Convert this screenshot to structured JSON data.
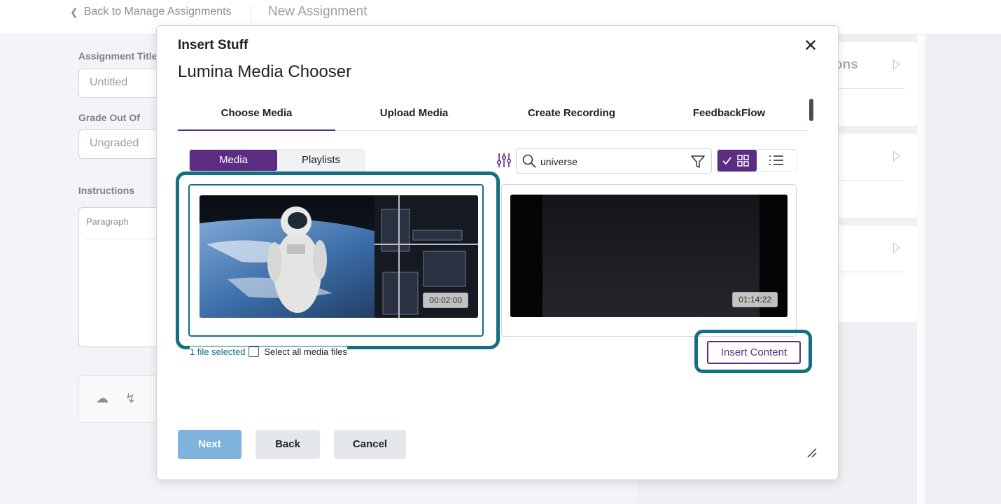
{
  "page": {
    "back_link": "Back to Manage Assignments",
    "title": "New Assignment",
    "labels": {
      "assignment_title": "Assignment Title",
      "grade_out_of": "Grade Out Of",
      "instructions": "Instructions"
    },
    "fields": {
      "title_placeholder": "Untitled",
      "grade_placeholder": "Ungraded",
      "paragraph_select": "Paragraph"
    },
    "right_cards": [
      {
        "partial_text": "ons"
      },
      {
        "partial_text": ""
      },
      {
        "partial_text": ""
      }
    ]
  },
  "dialog": {
    "title": "Insert Stuff",
    "subtitle": "Lumina Media Chooser",
    "tabs": [
      "Choose Media",
      "Upload Media",
      "Create Recording",
      "FeedbackFlow"
    ],
    "active_tab": "Choose Media",
    "segment": {
      "media": "Media",
      "playlists": "Playlists",
      "active": "Media"
    },
    "search": {
      "value": "universe"
    },
    "media": [
      {
        "kind": "video",
        "subject": "astronaut in space",
        "duration": "00:02:00",
        "selected": true
      },
      {
        "kind": "audio",
        "subject": "audio waveform",
        "duration": "01:14:22",
        "selected": false
      }
    ],
    "selection": {
      "count_text": "1 file selected",
      "select_all": "Select all media files"
    },
    "insert_button": "Insert Content",
    "buttons": {
      "next": "Next",
      "back": "Back",
      "cancel": "Cancel"
    },
    "colors": {
      "accent": "#5a2d82",
      "highlight": "#127080",
      "next_bg": "#7fb3dd"
    }
  }
}
